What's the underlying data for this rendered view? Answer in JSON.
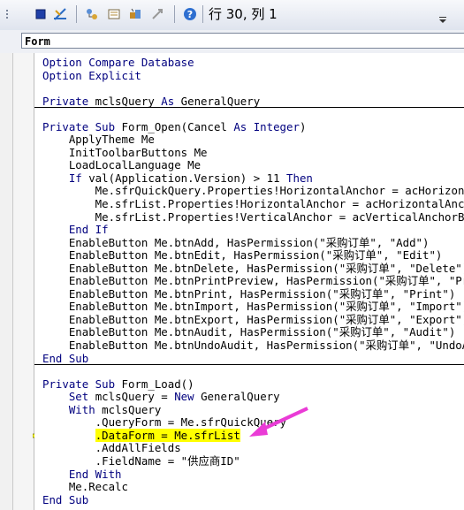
{
  "toolbar": {
    "status_text": "行 30, 列 1",
    "icons": [
      "toolbar-grip-icon",
      "stop-icon",
      "design-mode-icon",
      "project-explorer-icon",
      "properties-window-icon",
      "object-browser-icon",
      "toolbox-icon",
      "help-icon"
    ],
    "accent": "#ea3bd6"
  },
  "object_combo": {
    "value": "Form"
  },
  "code": {
    "lines": [
      {
        "segments": [
          {
            "t": "Option Compare Database",
            "k": true
          }
        ]
      },
      {
        "segments": [
          {
            "t": "Option Explicit",
            "k": true
          }
        ]
      },
      {
        "segments": [
          {
            "t": "",
            "k": false
          }
        ]
      },
      {
        "segments": [
          {
            "t": "Private",
            "k": true
          },
          {
            "t": " mclsQuery ",
            "k": false
          },
          {
            "t": "As",
            "k": true
          },
          {
            "t": " GeneralQuery",
            "k": false
          }
        ],
        "sep": true
      },
      {
        "segments": [
          {
            "t": "",
            "k": false
          }
        ]
      },
      {
        "segments": [
          {
            "t": "Private Sub",
            "k": true
          },
          {
            "t": " Form_Open(Cancel ",
            "k": false
          },
          {
            "t": "As Integer",
            "k": true
          },
          {
            "t": ")",
            "k": false
          }
        ]
      },
      {
        "segments": [
          {
            "t": "    ApplyTheme Me",
            "k": false
          }
        ]
      },
      {
        "segments": [
          {
            "t": "    InitToolbarButtons Me",
            "k": false
          }
        ]
      },
      {
        "segments": [
          {
            "t": "    LoadLocalLanguage Me",
            "k": false
          }
        ]
      },
      {
        "segments": [
          {
            "t": "    ",
            "k": false
          },
          {
            "t": "If",
            "k": true
          },
          {
            "t": " val(Application.Version) > 11 ",
            "k": false
          },
          {
            "t": "Then",
            "k": true
          }
        ]
      },
      {
        "segments": [
          {
            "t": "        Me.sfrQuickQuery.Properties!HorizontalAnchor = acHorizontalAnchorBoth",
            "k": false
          }
        ]
      },
      {
        "segments": [
          {
            "t": "        Me.sfrList.Properties!HorizontalAnchor = acHorizontalAnchorBoth",
            "k": false
          }
        ]
      },
      {
        "segments": [
          {
            "t": "        Me.sfrList.Properties!VerticalAnchor = acVerticalAnchorBoth",
            "k": false
          }
        ]
      },
      {
        "segments": [
          {
            "t": "    ",
            "k": false
          },
          {
            "t": "End If",
            "k": true
          }
        ]
      },
      {
        "segments": [
          {
            "t": "    EnableButton Me.btnAdd, HasPermission(\"采购订单\", \"Add\")",
            "k": false
          }
        ]
      },
      {
        "segments": [
          {
            "t": "    EnableButton Me.btnEdit, HasPermission(\"采购订单\", \"Edit\")",
            "k": false
          }
        ]
      },
      {
        "segments": [
          {
            "t": "    EnableButton Me.btnDelete, HasPermission(\"采购订单\", \"Delete\")",
            "k": false
          }
        ]
      },
      {
        "segments": [
          {
            "t": "    EnableButton Me.btnPrintPreview, HasPermission(\"采购订单\", \"Print\")",
            "k": false
          }
        ]
      },
      {
        "segments": [
          {
            "t": "    EnableButton Me.btnPrint, HasPermission(\"采购订单\", \"Print\")",
            "k": false
          }
        ]
      },
      {
        "segments": [
          {
            "t": "    EnableButton Me.btnImport, HasPermission(\"采购订单\", \"Import\")",
            "k": false
          }
        ]
      },
      {
        "segments": [
          {
            "t": "    EnableButton Me.btnExport, HasPermission(\"采购订单\", \"Export\")",
            "k": false
          }
        ]
      },
      {
        "segments": [
          {
            "t": "    EnableButton Me.btnAudit, HasPermission(\"采购订单\", \"Audit\")",
            "k": false
          }
        ]
      },
      {
        "segments": [
          {
            "t": "    EnableButton Me.btnUndoAudit, HasPermission(\"采购订单\", \"UndoAudit\")",
            "k": false
          }
        ]
      },
      {
        "segments": [
          {
            "t": "End Sub",
            "k": true
          }
        ],
        "sep": true
      },
      {
        "segments": [
          {
            "t": "",
            "k": false
          }
        ]
      },
      {
        "segments": [
          {
            "t": "Private Sub",
            "k": true
          },
          {
            "t": " Form_Load()",
            "k": false
          }
        ]
      },
      {
        "segments": [
          {
            "t": "    ",
            "k": false
          },
          {
            "t": "Set",
            "k": true
          },
          {
            "t": " mclsQuery = ",
            "k": false
          },
          {
            "t": "New",
            "k": true
          },
          {
            "t": " GeneralQuery",
            "k": false
          }
        ]
      },
      {
        "segments": [
          {
            "t": "    ",
            "k": false
          },
          {
            "t": "With",
            "k": true
          },
          {
            "t": " mclsQuery",
            "k": false
          }
        ]
      },
      {
        "segments": [
          {
            "t": "        .QueryForm = Me.sfrQuickQuery",
            "k": false
          }
        ]
      },
      {
        "segments": [
          {
            "t": "        ",
            "k": false
          },
          {
            "t": ".DataForm = Me.sfrList",
            "k": false,
            "h": true
          }
        ],
        "current": true
      },
      {
        "segments": [
          {
            "t": "        .AddAllFields",
            "k": false
          }
        ]
      },
      {
        "segments": [
          {
            "t": "        .FieldName = \"供应商ID\"",
            "k": false
          }
        ]
      },
      {
        "segments": [
          {
            "t": "    ",
            "k": false
          },
          {
            "t": "End With",
            "k": true
          }
        ]
      },
      {
        "segments": [
          {
            "t": "    Me.Recalc",
            "k": false
          }
        ]
      },
      {
        "segments": [
          {
            "t": "End Sub",
            "k": true
          }
        ]
      }
    ]
  }
}
